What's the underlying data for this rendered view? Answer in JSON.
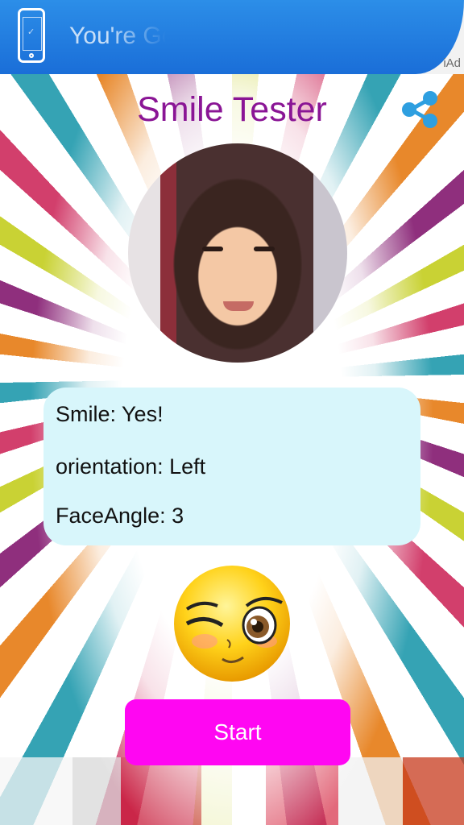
{
  "ad": {
    "text": "You're Go",
    "provider_label": "iAd",
    "icon": "phone-icon",
    "color": "#1a6ed8"
  },
  "app": {
    "title": "Smile Tester",
    "title_color": "#8a1595",
    "share_icon": "share-icon",
    "share_color": "#2e9fe0"
  },
  "photo": {
    "subject": "face-photo"
  },
  "results": {
    "smile": "Smile: Yes!",
    "orientation": "orientation: Left",
    "face_angle": "FaceAngle: 3"
  },
  "emoji": {
    "icon": "winking-emoji-icon"
  },
  "start_button": {
    "label": "Start",
    "color": "#ff06f2"
  }
}
